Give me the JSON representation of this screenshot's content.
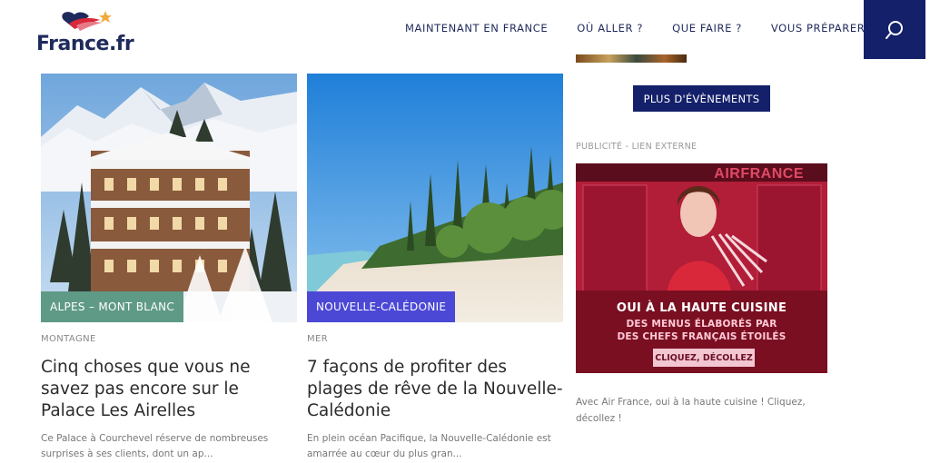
{
  "header": {
    "logo_text": "France.fr",
    "nav": [
      {
        "label": "MAINTENANT EN FRANCE"
      },
      {
        "label": "OÙ ALLER ?"
      },
      {
        "label": "QUE FAIRE ?"
      },
      {
        "label": "VOUS PRÉPARER"
      }
    ],
    "search_icon": "search-icon"
  },
  "cards": [
    {
      "tag": "ALPES – MONT BLANC",
      "tag_color": "#5f9a86",
      "category": "MONTAGNE",
      "title": "Cinq choses que vous ne savez pas encore sur le Palace Les Airelles",
      "excerpt": "Ce Palace à Courchevel réserve de nombreuses surprises à ses clients, dont un ap..."
    },
    {
      "tag": "NOUVELLE-CALÉDONIE",
      "tag_color": "#4b48d6",
      "category": "MER",
      "title": "7 façons de profiter des plages de rêve de la Nouvelle-Calédonie",
      "excerpt": "En plein océan Pacifique, la Nouvelle-Calédonie est amarrée au cœur du plus gran..."
    }
  ],
  "sidebar": {
    "events_button": "PLUS D'ÉVÈNEMENTS",
    "ad_label": "PUBLICITÉ - LIEN EXTERNE",
    "ad": {
      "brand": "AIRFRANCE",
      "headline": "OUI À LA HAUTE CUISINE",
      "sub1": "DES MENUS ÉLABORÉS PAR",
      "sub2": "DES CHEFS FRANÇAIS ÉTOILÉS",
      "cta": "CLIQUEZ, DÉCOLLEZ"
    },
    "ad_caption": "Avec Air France, oui à la haute cuisine ! Cliquez, décollez !"
  },
  "colors": {
    "navy": "#14206a",
    "nav_text": "#1f2a5c"
  }
}
